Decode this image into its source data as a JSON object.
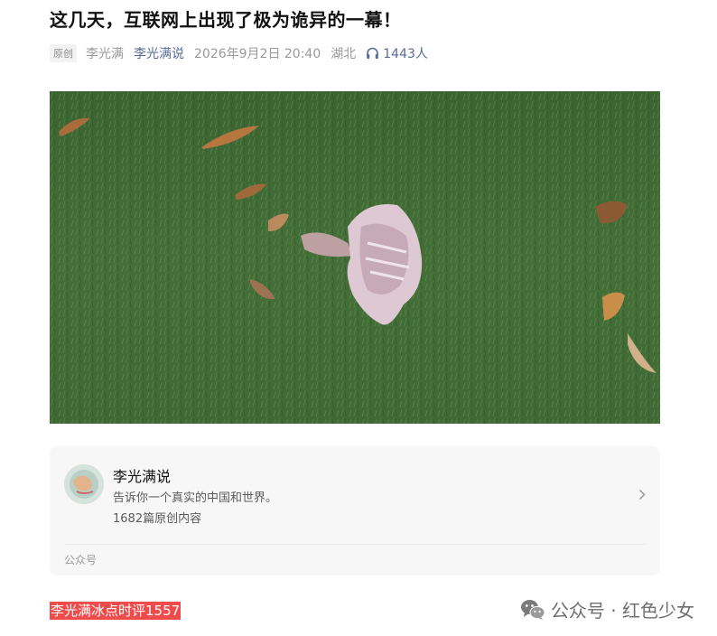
{
  "article": {
    "title": "这几天，互联网上出现了极为诡异的一幕！",
    "badge": "原创",
    "author": "李光满",
    "account": "李光满说",
    "datetime": "2026年9月2日 20:40",
    "location": "湖北",
    "listen_count": "1443人"
  },
  "image": {
    "alt": "草地上的白色蘑菇"
  },
  "profile_card": {
    "name": "李光满说",
    "description": "告诉你一个真实的中国和世界。",
    "original_count": "1682篇原创内容",
    "type": "公众号"
  },
  "highlight_text": "李光满冰点时评1557",
  "watermark": {
    "text": "公众号 · 红色少女"
  },
  "colors": {
    "link_blue": "#576b95",
    "highlight_red": "#ef4b4b",
    "card_bg": "#f7f7f7"
  }
}
